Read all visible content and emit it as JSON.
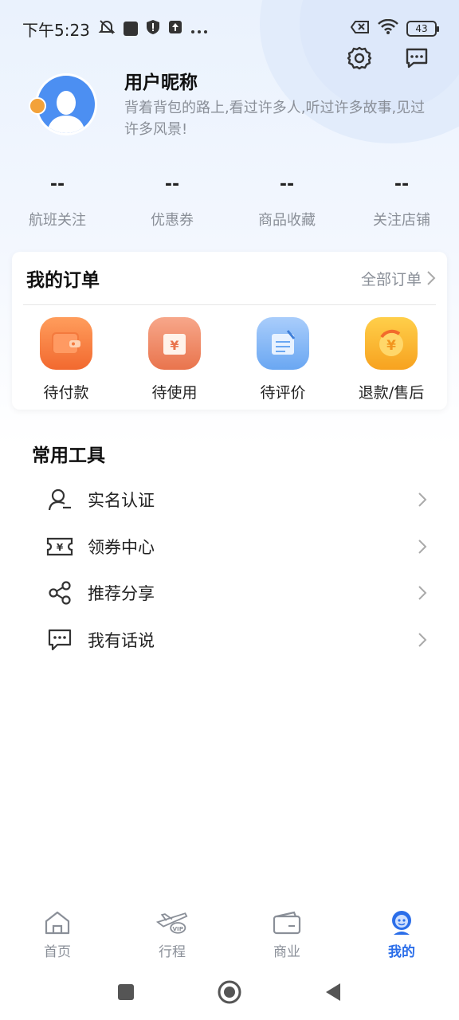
{
  "status_bar": {
    "time": "下午5:23",
    "battery": "43"
  },
  "profile": {
    "nickname": "用户昵称",
    "bio": "背着背包的路上,看过许多人,听过许多故事,见过许多风景!"
  },
  "stats": [
    {
      "value": "--",
      "label": "航班关注"
    },
    {
      "value": "--",
      "label": "优惠券"
    },
    {
      "value": "--",
      "label": "商品收藏"
    },
    {
      "value": "--",
      "label": "关注店铺"
    }
  ],
  "orders": {
    "title": "我的订单",
    "all_label": "全部订单",
    "items": [
      {
        "label": "待付款",
        "icon": "wallet-icon"
      },
      {
        "label": "待使用",
        "icon": "ticket-yen-icon"
      },
      {
        "label": "待评价",
        "icon": "review-note-icon"
      },
      {
        "label": "退款/售后",
        "icon": "refund-coin-icon"
      }
    ]
  },
  "tools": {
    "title": "常用工具",
    "items": [
      {
        "label": "实名认证",
        "icon": "user-id-icon"
      },
      {
        "label": "领券中心",
        "icon": "coupon-icon"
      },
      {
        "label": "推荐分享",
        "icon": "share-icon"
      },
      {
        "label": "我有话说",
        "icon": "chat-bubble-icon"
      }
    ]
  },
  "bottom_nav": [
    {
      "label": "首页",
      "icon": "home-icon",
      "active": false
    },
    {
      "label": "行程",
      "icon": "plane-vip-icon",
      "active": false
    },
    {
      "label": "商业",
      "icon": "wallet-card-icon",
      "active": false
    },
    {
      "label": "我的",
      "icon": "mascot-icon",
      "active": true
    }
  ],
  "colors": {
    "accent": "#2b6ee9",
    "muted": "#8a8f98"
  }
}
